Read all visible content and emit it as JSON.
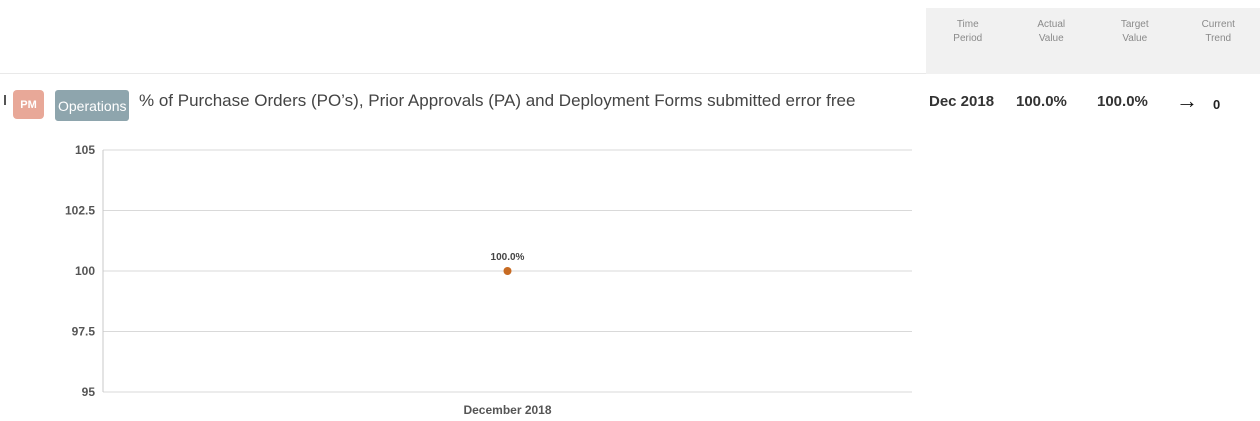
{
  "table_header": {
    "columns": [
      "Time\nPeriod",
      "Actual\nValue",
      "Target\nValue",
      "Current\nTrend"
    ]
  },
  "kpi": {
    "badge_pm": "PM",
    "badge_category": "Operations",
    "title": "% of Purchase Orders (PO’s), Prior Approvals (PA) and Deployment Forms submitted error free",
    "time_period": "Dec 2018",
    "actual_value": "100.0%",
    "target_value": "100.0%",
    "trend_icon": "right-arrow-icon",
    "trend_symbol": "→",
    "trend_value": "0"
  },
  "chart_data": {
    "type": "scatter",
    "categories": [
      "December 2018"
    ],
    "series": [
      {
        "values": [
          100.0
        ],
        "labels": [
          "100.0%"
        ],
        "color": "#c76b23"
      }
    ],
    "yticks": [
      "105",
      "102.5",
      "100",
      "97.5",
      "95"
    ],
    "ytick_values": [
      105,
      102.5,
      100,
      97.5,
      95
    ],
    "ylim": [
      95,
      105
    ],
    "grid": true,
    "colors": {
      "grid": "#d9d9d9",
      "axis": "#c8c8c8"
    }
  }
}
